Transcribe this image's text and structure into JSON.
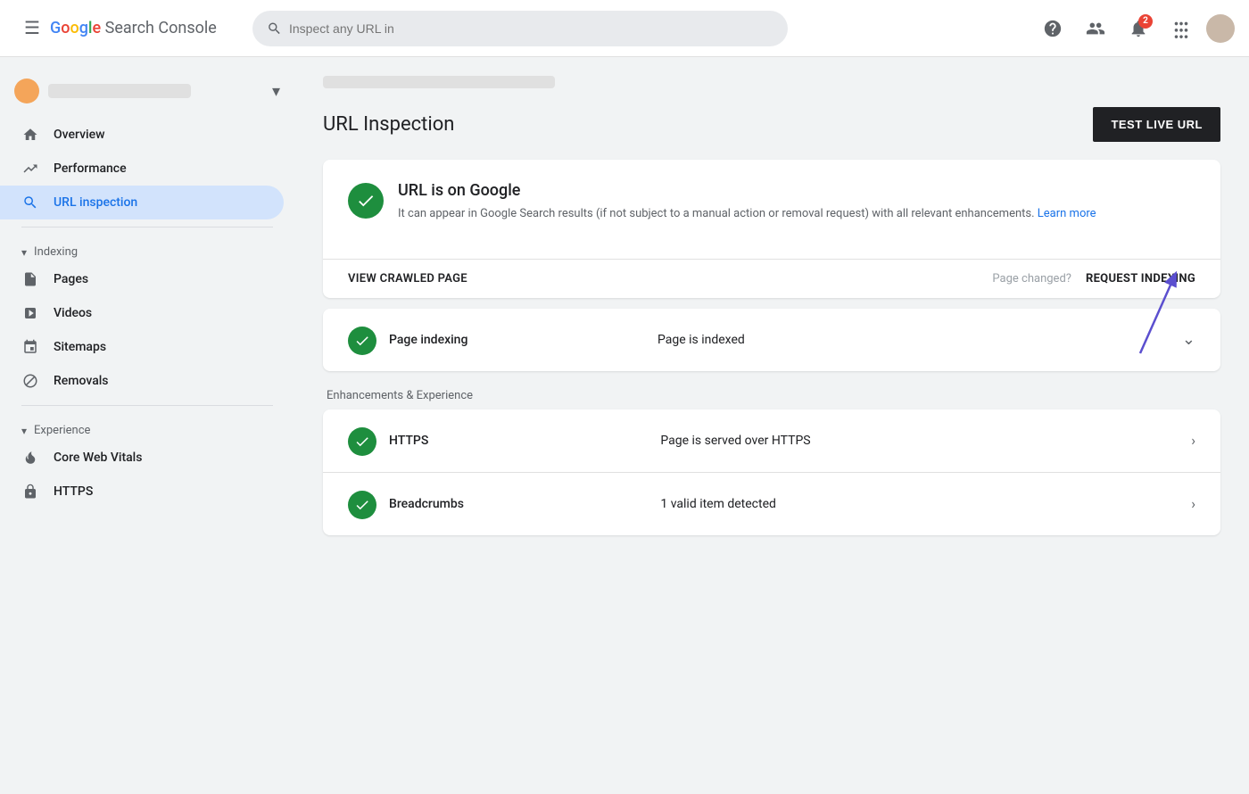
{
  "app": {
    "title": "Google Search Console",
    "logo_g": "G",
    "logo_rest": "oogle Search Console"
  },
  "header": {
    "search_placeholder": "Inspect any URL in",
    "notification_count": "2",
    "menu_icon": "☰",
    "grid_icon": "⠿"
  },
  "sidebar": {
    "property_name": "",
    "nav_items": [
      {
        "id": "overview",
        "label": "Overview",
        "icon": "🏠",
        "active": false
      },
      {
        "id": "performance",
        "label": "Performance",
        "icon": "↗",
        "active": false
      },
      {
        "id": "url-inspection",
        "label": "URL inspection",
        "icon": "🔍",
        "active": true
      }
    ],
    "indexing_section": {
      "label": "Indexing",
      "items": [
        {
          "id": "pages",
          "label": "Pages",
          "icon": "📄"
        },
        {
          "id": "videos",
          "label": "Videos",
          "icon": "🎬"
        },
        {
          "id": "sitemaps",
          "label": "Sitemaps",
          "icon": "🗺"
        },
        {
          "id": "removals",
          "label": "Removals",
          "icon": "🚫"
        }
      ]
    },
    "experience_section": {
      "label": "Experience",
      "items": [
        {
          "id": "core-web-vitals",
          "label": "Core Web Vitals",
          "icon": "⏱"
        },
        {
          "id": "https",
          "label": "HTTPS",
          "icon": "🔒"
        }
      ]
    }
  },
  "main": {
    "page_url": "",
    "page_title": "URL Inspection",
    "test_live_btn": "TEST LIVE URL",
    "url_status_card": {
      "title": "URL is on Google",
      "description": "It can appear in Google Search results (if not subject to a manual action or removal request) with all relevant enhancements.",
      "learn_more": "Learn more",
      "view_crawled": "VIEW CRAWLED PAGE",
      "page_changed": "Page changed?",
      "request_indexing": "REQUEST INDEXING"
    },
    "indexing_row": {
      "label": "Page indexing",
      "status": "Page is indexed"
    },
    "enhancements_header": "Enhancements & Experience",
    "enhancements": [
      {
        "label": "HTTPS",
        "status": "Page is served over HTTPS"
      },
      {
        "label": "Breadcrumbs",
        "status": "1 valid item detected"
      }
    ]
  }
}
